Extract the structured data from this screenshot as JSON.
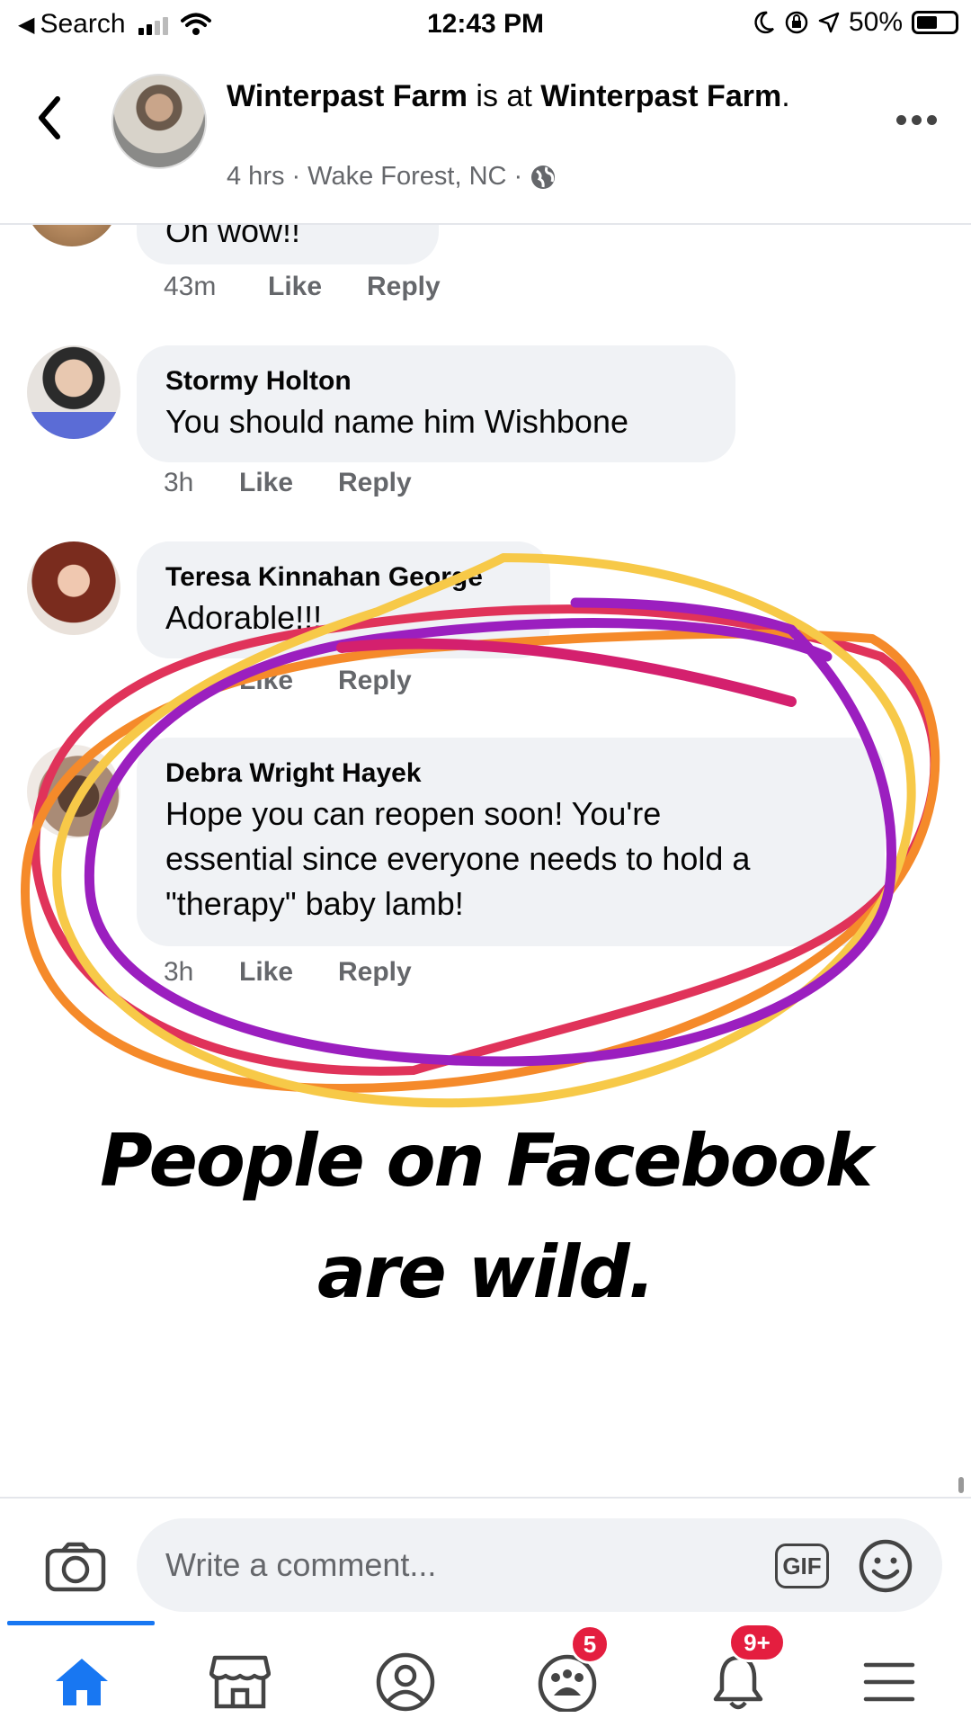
{
  "status_bar": {
    "back_label": "Search",
    "time": "12:43 PM",
    "battery": "50%",
    "icons": [
      "back-arrow-icon",
      "signal-icon",
      "wifi-icon",
      "moon-icon",
      "lock-rotation-icon",
      "location-icon",
      "battery-icon"
    ]
  },
  "header": {
    "page_name": "Winterpast Farm",
    "connector": " is at ",
    "place": "Winterpast Farm",
    "place_suffix": ".",
    "time_ago": "4 hrs",
    "location": "Wake Forest, NC",
    "separator": "·"
  },
  "comments": [
    {
      "author": "",
      "text": "Oh wow!!",
      "time": "43m",
      "like_label": "Like",
      "reply_label": "Reply"
    },
    {
      "author": "Stormy Holton",
      "text": "You should name him Wishbone",
      "time": "3h",
      "like_label": "Like",
      "reply_label": "Reply",
      "avatar_badge": "#StayHome"
    },
    {
      "author": "Teresa Kinnahan George",
      "text": "Adorable!!!",
      "time": "",
      "like_label": "Like",
      "reply_label": "Reply"
    },
    {
      "author": "Debra Wright Hayek",
      "text_lines": [
        "Hope you can reopen soon!  You're",
        "essential since everyone needs to hold a",
        "\"therapy\" baby lamb!"
      ],
      "time": "3h",
      "like_label": "Like",
      "reply_label": "Reply"
    }
  ],
  "caption": {
    "line1": "People on Facebook",
    "line2": "are wild."
  },
  "composer": {
    "placeholder": "Write a comment...",
    "gif_label": "GIF"
  },
  "tabbar": {
    "tabs": [
      {
        "name": "home",
        "icon": "home-icon",
        "active": true
      },
      {
        "name": "marketplace",
        "icon": "marketplace-icon"
      },
      {
        "name": "profile",
        "icon": "profile-icon"
      },
      {
        "name": "groups",
        "icon": "groups-icon",
        "badge": "5"
      },
      {
        "name": "notifications",
        "icon": "bell-icon",
        "badge": "9+"
      },
      {
        "name": "menu",
        "icon": "menu-icon"
      }
    ]
  },
  "colors": {
    "accent": "#1877f2",
    "badge": "#e41e3f",
    "bubble": "#f0f2f5",
    "muted_text": "#65676b",
    "annotation_purple": "#9b1fbf",
    "annotation_orange": "#f58a2a",
    "annotation_yellow": "#f7c948",
    "annotation_red": "#e0335a"
  }
}
